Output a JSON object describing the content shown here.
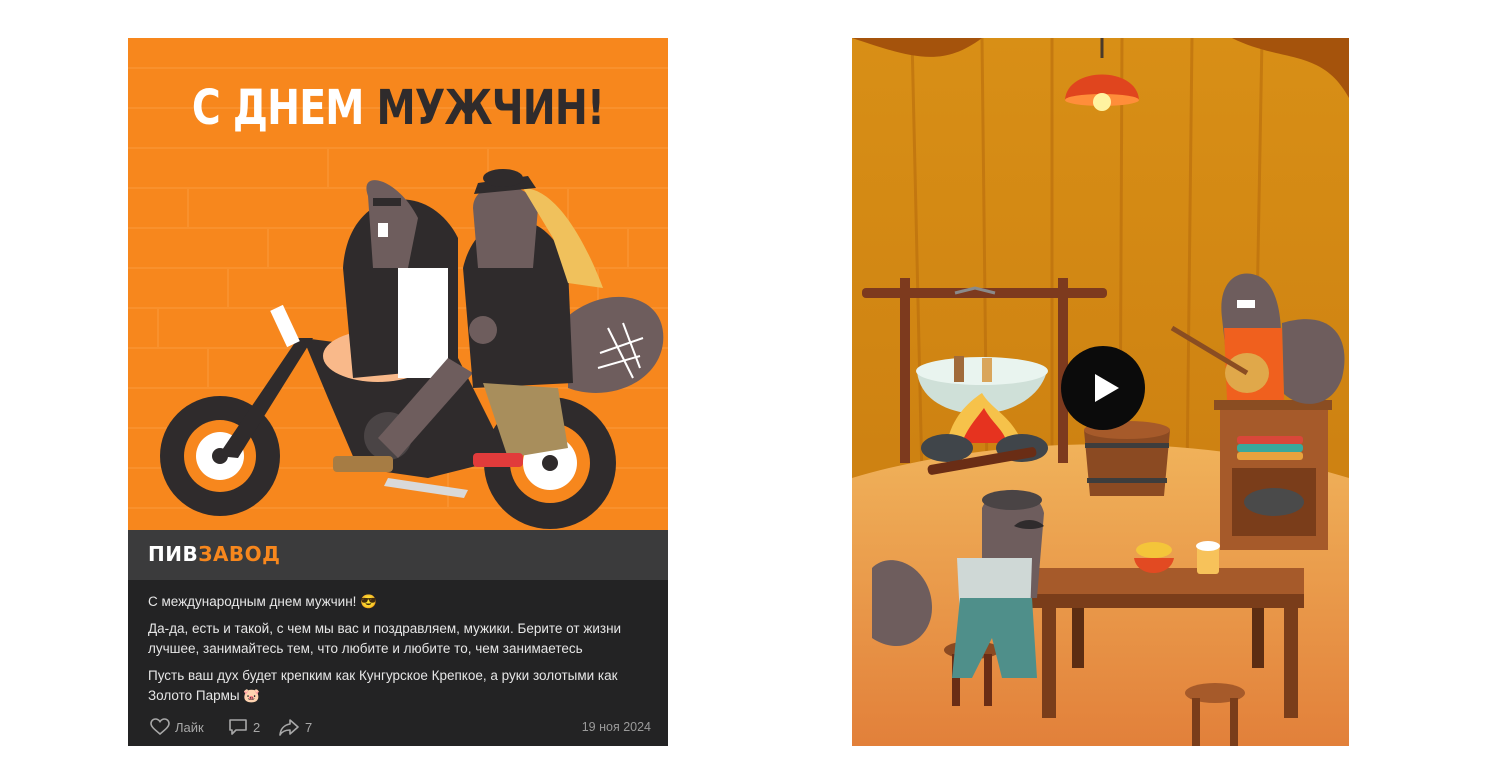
{
  "post": {
    "image": {
      "headline_part1": "С ДНЕМ ",
      "headline_part2": "МУЖЧИН!"
    },
    "brand": {
      "logo_part1": "ПИВ",
      "logo_part2": "ЗАВОД"
    },
    "text": {
      "line1": "С международным днем мужчин! 😎",
      "line2": "Да-да, есть и такой, с чем мы вас и поздравляем, мужики. Берите от жизни лучшее, занимайтесь тем, что любите и любите то, чем занимаетесь",
      "line3": "Пусть ваш дух будет крепким как Кунгурское Крепкое, а руки золотыми как Золото Пармы 🐷"
    },
    "footer": {
      "like_label": "Лайк",
      "comments_count": "2",
      "shares_count": "7",
      "date": "19 ноя 2024"
    }
  },
  "video": {
    "icons": {
      "play": "play-icon"
    }
  },
  "colors": {
    "orange": "#f7871d",
    "dark": "#232324",
    "bar": "#3b3b3c"
  }
}
